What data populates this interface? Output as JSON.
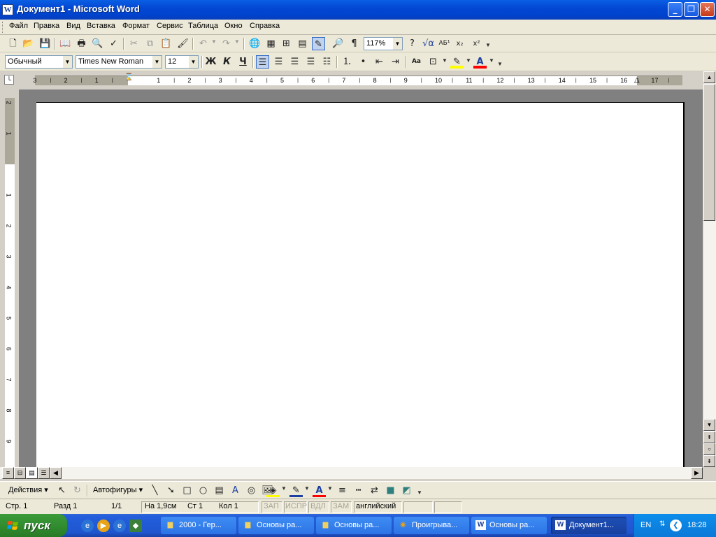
{
  "window": {
    "title": "Документ1 - Microsoft Word",
    "app_icon_letter": "W"
  },
  "menu": [
    {
      "label": "Файл"
    },
    {
      "label": "Правка"
    },
    {
      "label": "Вид"
    },
    {
      "label": "Вставка"
    },
    {
      "label": "Формат"
    },
    {
      "label": "Сервис"
    },
    {
      "label": "Таблица"
    },
    {
      "label": "Окно"
    },
    {
      "label": "Справка"
    }
  ],
  "standard_toolbar": {
    "zoom": "117%"
  },
  "formatting_toolbar": {
    "style": "Обычный",
    "font": "Times New Roman",
    "size": "12",
    "bold": "Ж",
    "italic": "К",
    "underline": "Ч"
  },
  "ruler": {
    "h_numbers": [
      "3",
      "2",
      "1",
      "1",
      "2",
      "3",
      "4",
      "5",
      "6",
      "7",
      "8",
      "9",
      "10",
      "11",
      "12",
      "13",
      "14",
      "15",
      "16",
      "17"
    ],
    "v_numbers": [
      "2",
      "1",
      "1",
      "2",
      "3",
      "4",
      "5",
      "6",
      "7",
      "8",
      "9"
    ]
  },
  "drawing_toolbar": {
    "actions": "Действия",
    "autoshapes": "Автофигуры"
  },
  "status": {
    "page": "Стр. 1",
    "section": "Разд 1",
    "pages": "1/1",
    "at": "На 1,9см",
    "line": "Ст 1",
    "col": "Кол 1",
    "rec": "ЗАП",
    "trk": "ИСПР",
    "ext": "ВДЛ",
    "ovr": "ЗАМ",
    "language": "английский"
  },
  "taskbar": {
    "start": "пуск",
    "tasks": [
      {
        "label": "2000 - Гер...",
        "icon": "folder-icon"
      },
      {
        "label": "Основы ра...",
        "icon": "folder-icon"
      },
      {
        "label": "Основы ра...",
        "icon": "folder-icon"
      },
      {
        "label": "Проигрыва...",
        "icon": "media-player-icon"
      },
      {
        "label": "Основы ра...",
        "icon": "word-icon"
      },
      {
        "label": "Документ1...",
        "icon": "word-icon",
        "active": true
      }
    ],
    "lang": "EN",
    "clock": "18:28"
  },
  "colors": {
    "title_bar": "#0348D3",
    "taskbar": "#245EDB",
    "start_button": "#2F8A2D",
    "tray": "#0B79D8",
    "highlight": "#FFFF00",
    "font_color": "#FF0000"
  }
}
